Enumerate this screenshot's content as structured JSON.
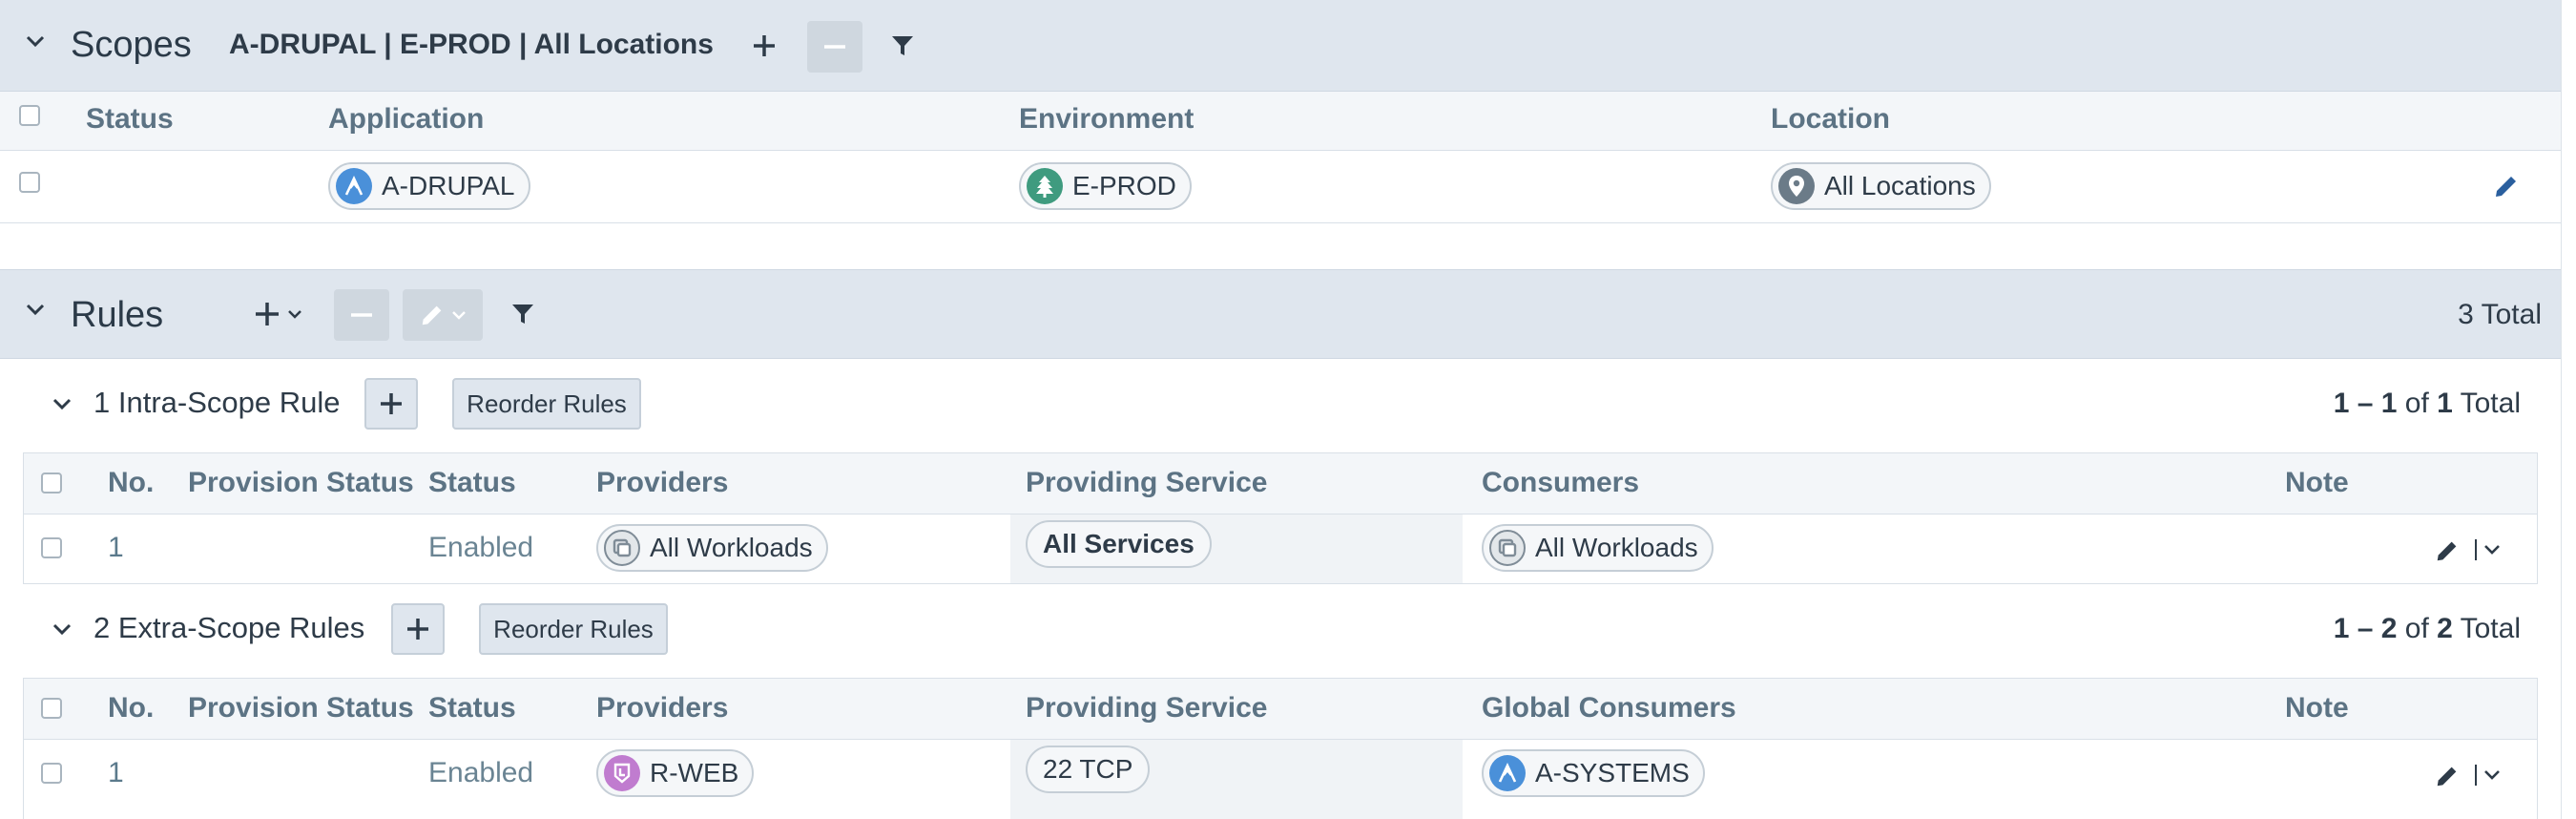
{
  "scopes": {
    "title": "Scopes",
    "scope_label": "A-DRUPAL | E-PROD | All Locations",
    "columns": [
      "Status",
      "Application",
      "Environment",
      "Location"
    ],
    "row": {
      "application": "A-DRUPAL",
      "environment": "E-PROD",
      "location": "All Locations"
    }
  },
  "rules": {
    "title": "Rules",
    "total": "3 Total",
    "intra": {
      "title": "1 Intra-Scope Rule",
      "reorder_label": "Reorder Rules",
      "count": {
        "range": "1 – 1",
        "of": "of",
        "total": "1",
        "suffix": "Total"
      },
      "columns": [
        "No.",
        "Provision Status",
        "Status",
        "Providers",
        "Providing Service",
        "Consumers",
        "Note"
      ],
      "rows": [
        {
          "no": "1",
          "status": "Enabled",
          "provider": "All Workloads",
          "service": "All Services",
          "consumer": "All Workloads"
        }
      ]
    },
    "extra": {
      "title": "2 Extra-Scope Rules",
      "reorder_label": "Reorder Rules",
      "count": {
        "range": "1 – 2",
        "of": "of",
        "total": "2",
        "suffix": "Total"
      },
      "columns": [
        "No.",
        "Provision Status",
        "Status",
        "Providers",
        "Providing Service",
        "Global Consumers",
        "Note"
      ],
      "rows": [
        {
          "no": "1",
          "status": "Enabled",
          "provider": "R-WEB",
          "service": "22 TCP",
          "consumer": "A-SYSTEMS"
        }
      ]
    }
  },
  "colors": {
    "header_bg": "#dfe6ee",
    "app_icon": "#4a90d9",
    "env_icon": "#3f9b7f",
    "loc_icon": "#6b7b88",
    "role_icon": "#c07ccf",
    "workload_icon": "#7f8c97",
    "edit_icon": "#2a5f9e"
  }
}
